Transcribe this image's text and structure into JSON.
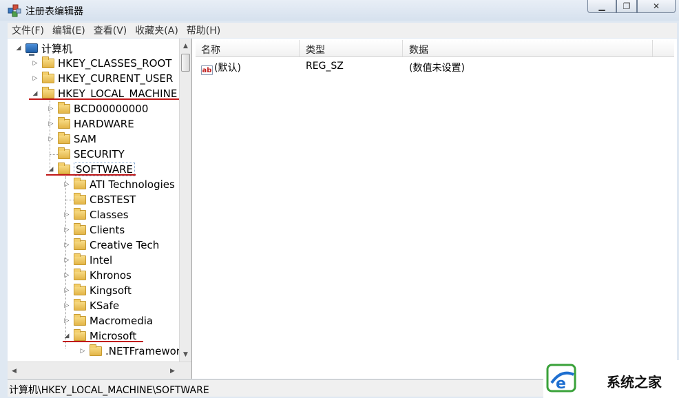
{
  "window": {
    "title": "注册表编辑器"
  },
  "menu": [
    "文件(F)",
    "编辑(E)",
    "查看(V)",
    "收藏夹(A)",
    "帮助(H)"
  ],
  "tree": [
    {
      "label": "计算机",
      "level": 0,
      "expanded": true
    },
    {
      "label": "HKEY_CLASSES_ROOT",
      "level": 1,
      "expanded": false
    },
    {
      "label": "HKEY_CURRENT_USER",
      "level": 1,
      "expanded": false
    },
    {
      "label": "HKEY_LOCAL_MACHINE",
      "level": 1,
      "expanded": true
    },
    {
      "label": "BCD00000000",
      "level": 2,
      "expanded": false
    },
    {
      "label": "HARDWARE",
      "level": 2,
      "expanded": false
    },
    {
      "label": "SAM",
      "level": 2,
      "expanded": false
    },
    {
      "label": "SECURITY",
      "level": 2
    },
    {
      "label": "SOFTWARE",
      "level": 2,
      "expanded": true,
      "selected": true
    },
    {
      "label": "ATI Technologies",
      "level": 3,
      "expanded": false
    },
    {
      "label": "CBSTEST",
      "level": 3
    },
    {
      "label": "Classes",
      "level": 3,
      "expanded": false
    },
    {
      "label": "Clients",
      "level": 3,
      "expanded": false
    },
    {
      "label": "Creative Tech",
      "level": 3,
      "expanded": false
    },
    {
      "label": "Intel",
      "level": 3,
      "expanded": false
    },
    {
      "label": "Khronos",
      "level": 3,
      "expanded": false
    },
    {
      "label": "Kingsoft",
      "level": 3,
      "expanded": false
    },
    {
      "label": "KSafe",
      "level": 3,
      "expanded": false
    },
    {
      "label": "Macromedia",
      "level": 3,
      "expanded": false
    },
    {
      "label": "Microsoft",
      "level": 3,
      "expanded": true
    },
    {
      "label": ".NETFramework",
      "level": 4,
      "expanded": false
    }
  ],
  "list": {
    "columns": [
      "名称",
      "类型",
      "数据"
    ],
    "rows": [
      {
        "name": "(默认)",
        "type": "REG_SZ",
        "data": "(数值未设置)",
        "icon": "string-value-icon"
      }
    ]
  },
  "status": "计算机\\HKEY_LOCAL_MACHINE\\SOFTWARE",
  "watermark": {
    "text": "系统之家"
  },
  "colors": {
    "highlight_underline": "#c01818",
    "title_bar": "#dfe8f2"
  }
}
